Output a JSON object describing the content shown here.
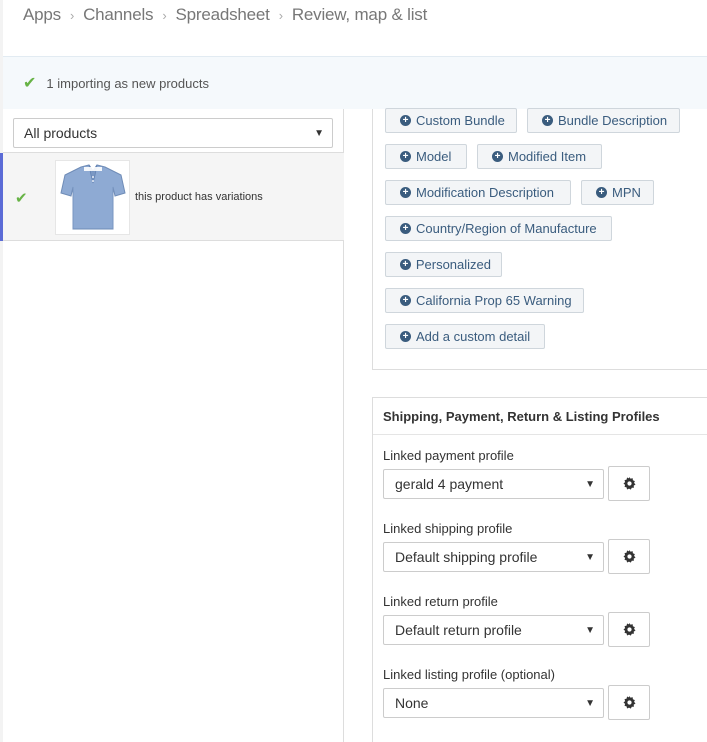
{
  "breadcrumb": [
    "Apps",
    "Channels",
    "Spreadsheet",
    "Review, map & list"
  ],
  "notice": {
    "text": "1 importing as new products"
  },
  "left": {
    "filter": {
      "value": "All products"
    },
    "product": {
      "text": "this product has variations"
    }
  },
  "attributes": {
    "buttons": [
      "Custom Bundle",
      "Bundle Description",
      "Model",
      "Modified Item",
      "Modification Description",
      "MPN",
      "Country/Region of Manufacture",
      "Personalized",
      "California Prop 65 Warning",
      "Add a custom detail"
    ]
  },
  "profiles": {
    "title": "Shipping, Payment, Return & Listing Profiles",
    "payment": {
      "label": "Linked payment profile",
      "value": "gerald 4 payment"
    },
    "shipping": {
      "label": "Linked shipping profile",
      "value": "Default shipping profile"
    },
    "return": {
      "label": "Linked return profile",
      "value": "Default return profile"
    },
    "listing": {
      "label": "Linked listing profile (optional)",
      "value": "None"
    }
  },
  "colors": {
    "accent": "#3a5c7e",
    "check": "#67b346",
    "notice_bg": "#f5f9fc"
  }
}
